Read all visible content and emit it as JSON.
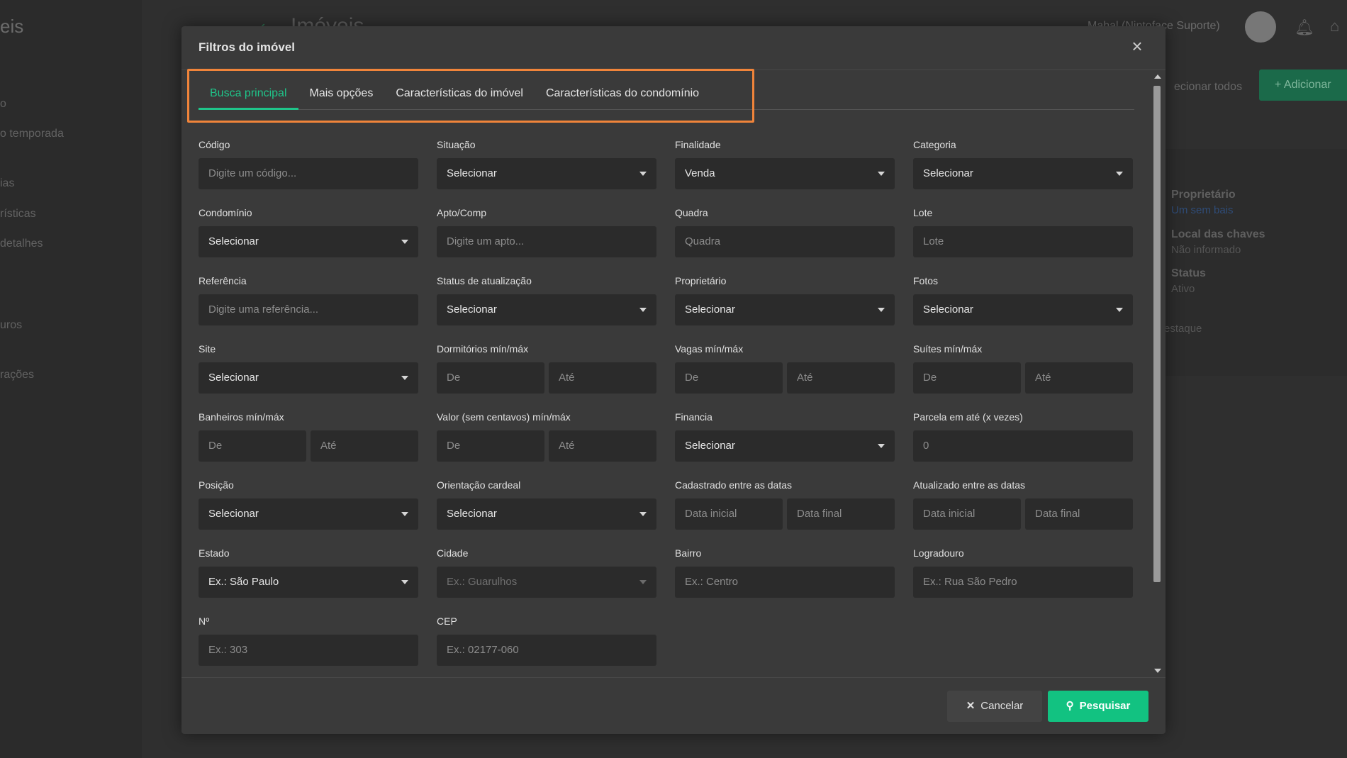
{
  "background": {
    "brand": "eis",
    "nav_items": [
      "o",
      "o temporada",
      "ias",
      "rísticas",
      "detalhes",
      "uros",
      "rações"
    ],
    "page_title": "Imóveis",
    "user_name": "Mahal (Nintoface Suporte)",
    "select_all": "ecionar todos",
    "add_button": "+ Adicionar",
    "details": [
      {
        "label": "Proprietário",
        "value": "Um sem bais"
      },
      {
        "label": "Local das chaves",
        "value": "Não informado"
      },
      {
        "label": "Status",
        "value": "Ativo"
      }
    ],
    "destaque": "estaque"
  },
  "modal": {
    "title": "Filtros do imóvel",
    "close_icon": "close-icon",
    "tabs": [
      {
        "label": "Busca principal",
        "active": true
      },
      {
        "label": "Mais opções",
        "active": false
      },
      {
        "label": "Características do imóvel",
        "active": false
      },
      {
        "label": "Características do condomínio",
        "active": false
      }
    ],
    "fields": {
      "codigo": {
        "label": "Código",
        "placeholder": "Digite um código..."
      },
      "situacao": {
        "label": "Situação",
        "value": "Selecionar"
      },
      "finalidade": {
        "label": "Finalidade",
        "value": "Venda"
      },
      "categoria": {
        "label": "Categoria",
        "value": "Selecionar"
      },
      "condominio": {
        "label": "Condomínio",
        "value": "Selecionar"
      },
      "apto": {
        "label": "Apto/Comp",
        "placeholder": "Digite um apto..."
      },
      "quadra": {
        "label": "Quadra",
        "placeholder": "Quadra"
      },
      "lote": {
        "label": "Lote",
        "placeholder": "Lote"
      },
      "referencia": {
        "label": "Referência",
        "placeholder": "Digite uma referência..."
      },
      "status": {
        "label": "Status de atualização",
        "value": "Selecionar"
      },
      "proprietario": {
        "label": "Proprietário",
        "value": "Selecionar"
      },
      "fotos": {
        "label": "Fotos",
        "value": "Selecionar"
      },
      "site": {
        "label": "Site",
        "value": "Selecionar"
      },
      "dormitorios": {
        "label": "Dormitórios mín/máx",
        "from": "De",
        "to": "Até"
      },
      "vagas": {
        "label": "Vagas mín/máx",
        "from": "De",
        "to": "Até"
      },
      "suites": {
        "label": "Suítes mín/máx",
        "from": "De",
        "to": "Até"
      },
      "banheiros": {
        "label": "Banheiros mín/máx",
        "from": "De",
        "to": "Até"
      },
      "valor": {
        "label": "Valor (sem centavos) mín/máx",
        "from": "De",
        "to": "Até"
      },
      "financia": {
        "label": "Financia",
        "value": "Selecionar"
      },
      "parcela": {
        "label": "Parcela em até (x vezes)",
        "placeholder": "0"
      },
      "posicao": {
        "label": "Posição",
        "value": "Selecionar"
      },
      "orientacao": {
        "label": "Orientação cardeal",
        "value": "Selecionar"
      },
      "cadastrado": {
        "label": "Cadastrado entre as datas",
        "from": "Data inicial",
        "to": "Data final"
      },
      "atualizado": {
        "label": "Atualizado entre as datas",
        "from": "Data inicial",
        "to": "Data final"
      },
      "estado": {
        "label": "Estado",
        "value": "Ex.: São Paulo"
      },
      "cidade": {
        "label": "Cidade",
        "value": "Ex.: Guarulhos"
      },
      "bairro": {
        "label": "Bairro",
        "placeholder": "Ex.: Centro"
      },
      "logradouro": {
        "label": "Logradouro",
        "placeholder": "Ex.: Rua São Pedro"
      },
      "numero": {
        "label": "Nº",
        "placeholder": "Ex.: 303"
      },
      "cep": {
        "label": "CEP",
        "placeholder": "Ex.: 02177-060"
      }
    },
    "footer": {
      "cancel_label": "Cancelar",
      "search_label": "Pesquisar"
    }
  },
  "colors": {
    "accent": "#1fc58a",
    "highlight": "#f0843a"
  }
}
